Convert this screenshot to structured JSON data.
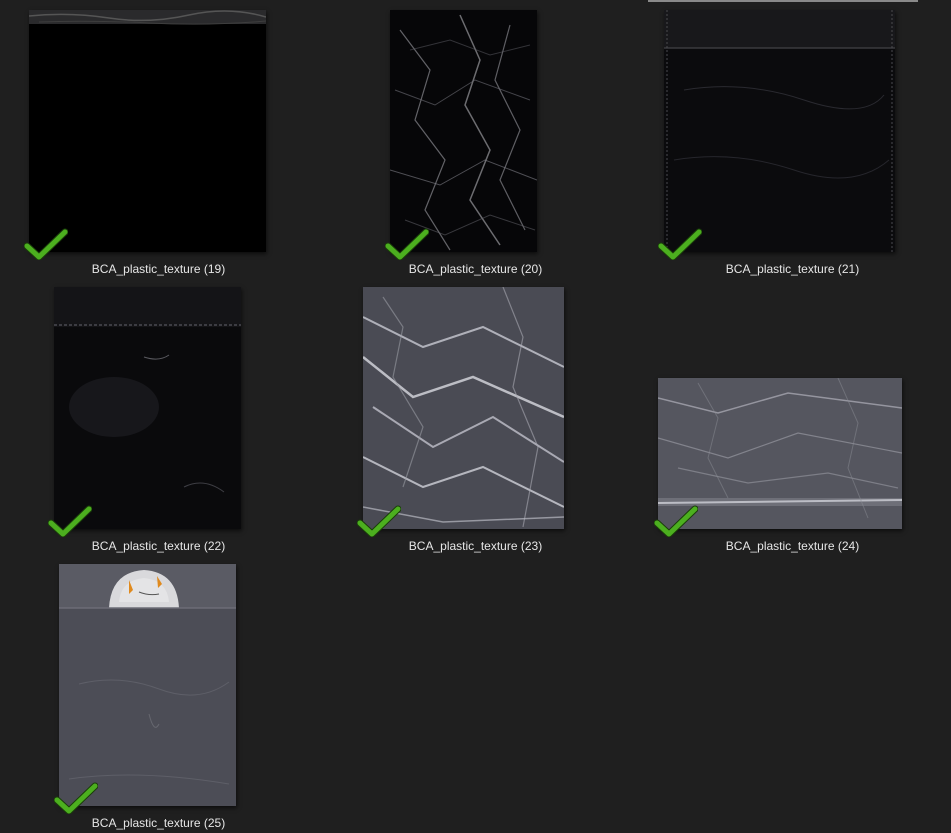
{
  "files": [
    {
      "name": "BCA_plastic_texture (19)",
      "checked": true,
      "style": "black"
    },
    {
      "name": "BCA_plastic_texture (20)",
      "checked": true,
      "style": "black-crumpled"
    },
    {
      "name": "BCA_plastic_texture (21)",
      "checked": true,
      "style": "black-bag"
    },
    {
      "name": "BCA_plastic_texture (22)",
      "checked": true,
      "style": "black-bag"
    },
    {
      "name": "BCA_plastic_texture (23)",
      "checked": true,
      "style": "clear-crumpled"
    },
    {
      "name": "BCA_plastic_texture (24)",
      "checked": true,
      "style": "clear-wide"
    },
    {
      "name": "BCA_plastic_texture (25)",
      "checked": true,
      "style": "clear-bag"
    }
  ],
  "icons": {
    "check": "green-check-icon"
  },
  "colors": {
    "background": "#1f1f1f",
    "check": "#4caf1f",
    "label": "#e6e6e6"
  }
}
